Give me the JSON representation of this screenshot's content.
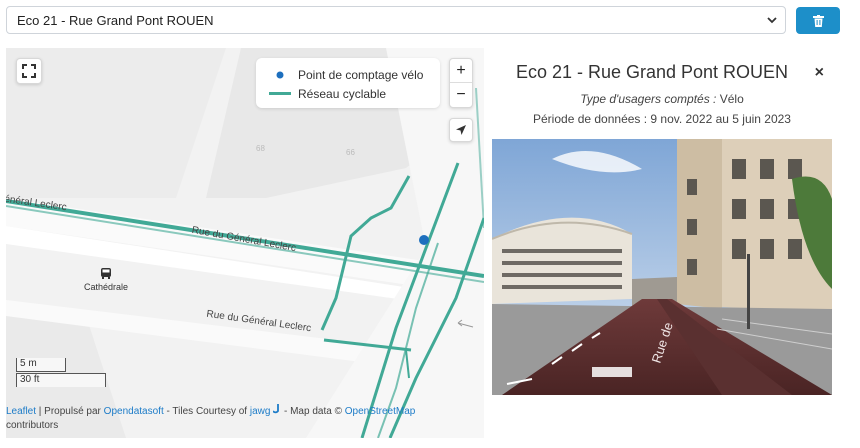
{
  "select": {
    "value": "Eco 21 - Rue Grand Pont ROUEN"
  },
  "map": {
    "legend": {
      "point_label": "Point de comptage vélo",
      "network_label": "Réseau cyclable",
      "point_color": "#1d6fbe",
      "network_color": "#41a996"
    },
    "zoom_in": "+",
    "zoom_out": "−",
    "labels": {
      "street_top": "Rue du Général Leclerc",
      "street_left": "énéral Leclerc",
      "street_bottom": "Rue du Général Leclerc",
      "poi": "Cathédrale",
      "block_a": "68",
      "block_b": "66"
    },
    "scale": {
      "metric": "5 m",
      "imperial": "30 ft"
    },
    "attribution": {
      "leaflet": "Leaflet",
      "powered_by": " | Propulsé par ",
      "opendatasoft": "Opendatasoft",
      "tiles": " - Tiles Courtesy of ",
      "jawg": "jawg",
      "map_data": " - Map data © ",
      "osm": "OpenStreetMap",
      "contributors": "contributors"
    }
  },
  "panel": {
    "title": "Eco 21 - Rue Grand Pont ROUEN",
    "close": "×",
    "type_label": "Type d'usagers comptés :",
    "type_value": " Vélo",
    "period": "Période de données : 9 nov. 2022 au 5 juin 2023",
    "photo_road_text": "Rue de"
  },
  "colors": {
    "accent": "#1d8fc9",
    "cycle_path": "#41a996",
    "counter_dot": "#1d6fbe"
  }
}
